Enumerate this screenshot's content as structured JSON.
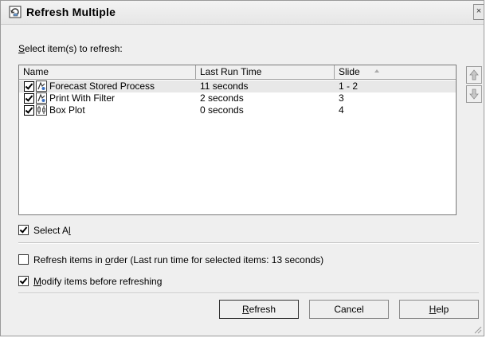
{
  "window": {
    "title": "Refresh Multiple",
    "close_glyph": "×"
  },
  "prompt": {
    "mnemonic": "S",
    "rest": "elect item(s) to refresh:"
  },
  "list": {
    "columns": {
      "name": "Name",
      "last_run_time": "Last Run Time",
      "slide": "Slide",
      "slide_sort": "ascending"
    },
    "rows": [
      {
        "checked": true,
        "icon": "stored-process-icon",
        "name": "Forecast Stored Process",
        "time": "11 seconds",
        "slide": "1 - 2",
        "selected": true
      },
      {
        "checked": true,
        "icon": "stored-process-icon",
        "name": "Print With Filter",
        "time": "2 seconds",
        "slide": "3",
        "selected": false
      },
      {
        "checked": true,
        "icon": "box-plot-icon",
        "name": "Box Plot",
        "time": "0 seconds",
        "slide": "4",
        "selected": false
      }
    ]
  },
  "move_buttons": {
    "up_icon": "move-up-icon",
    "down_icon": "move-down-icon"
  },
  "options": {
    "select_all": {
      "checked": true,
      "before": "Select A",
      "mnemonic": "l",
      "after": "l"
    },
    "refresh_in_order": {
      "checked": false,
      "before": "Refresh items in ",
      "mnemonic": "o",
      "after": "rder (Last run time for selected items: 13 seconds)"
    },
    "modify_before": {
      "checked": true,
      "before": "",
      "mnemonic": "M",
      "after": "odify items before refreshing"
    }
  },
  "buttons": {
    "refresh": {
      "mnemonic": "R",
      "rest": "efresh"
    },
    "cancel": "Cancel",
    "help": {
      "mnemonic": "H",
      "rest": "elp"
    }
  },
  "colors": {
    "dialog_bg": "#efefef",
    "selected_row": "#e8e8e8",
    "list_bg": "#ffffff"
  }
}
